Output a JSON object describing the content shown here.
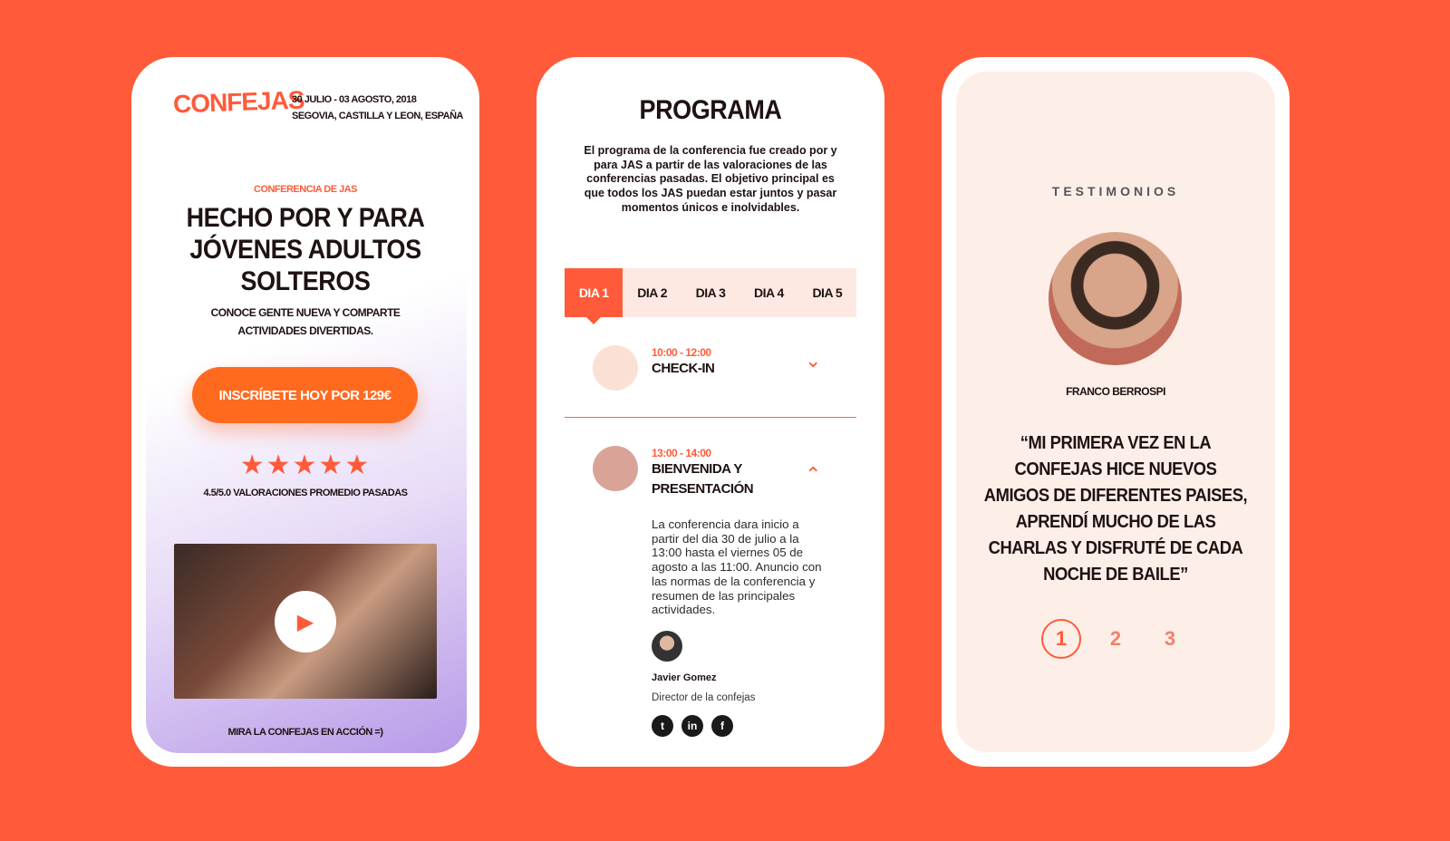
{
  "landing": {
    "logo": "CONFEJAS",
    "date_line": "30 JULIO - 03 AGOSTO, 2018",
    "location_line": "SEGOVIA, CASTILLA Y LEON, ESPAÑA",
    "eyebrow": "CONFERENCIA DE JAS",
    "headline": "HECHO POR Y PARA JÓVENES ADULTOS SOLTEROS",
    "subheadline": "CONOCE GENTE NUEVA Y COMPARTE ACTIVIDADES DIVERTIDAS.",
    "cta_label": "INSCRÍBETE HOY POR 129€",
    "stars": "★★★★★",
    "rating_text": "4.5/5.0 VALORACIONES PROMEDIO PASADAS",
    "rating_value": 4.5,
    "video_label": "MIRA LA CONFEJAS EN ACCIÓN =)"
  },
  "program": {
    "title": "PROGRAMA",
    "description": "El programa de la conferencia fue creado por y para JAS a partir de las valoraciones de las conferencias pasadas. El objetivo principal es que todos los JAS puedan estar juntos y pasar momentos únicos e inolvidables.",
    "tabs": [
      "DIA 1",
      "DIA 2",
      "DIA 3",
      "DIA 4",
      "DIA 5"
    ],
    "sessions": [
      {
        "time": "10:00 - 12:00",
        "title": "CHECK-IN"
      },
      {
        "time": "13:00 - 14:00",
        "title": "BIENVENIDA Y PRESENTACIÓN",
        "body": "La conferencia dara inicio a partir del dia 30 de julio a la 13:00 hasta el viernes 05 de agosto a las 11:00. Anuncio con las normas de la conferencia y resumen de las principales actividades.",
        "speaker_name": "Javier Gomez",
        "speaker_role": "Director de la confejas"
      }
    ],
    "social": [
      "t",
      "in",
      "f"
    ]
  },
  "testimonials": {
    "heading": "TESTIMONIOS",
    "name": "FRANCO BERROSPI",
    "quote": "“MI PRIMERA VEZ EN LA CONFEJAS HICE NUEVOS AMIGOS DE DIFERENTES PAISES, APRENDÍ MUCHO DE LAS CHARLAS Y DISFRUTÉ DE CADA NOCHE DE BAILE”",
    "pages": [
      "1",
      "2",
      "3"
    ]
  }
}
